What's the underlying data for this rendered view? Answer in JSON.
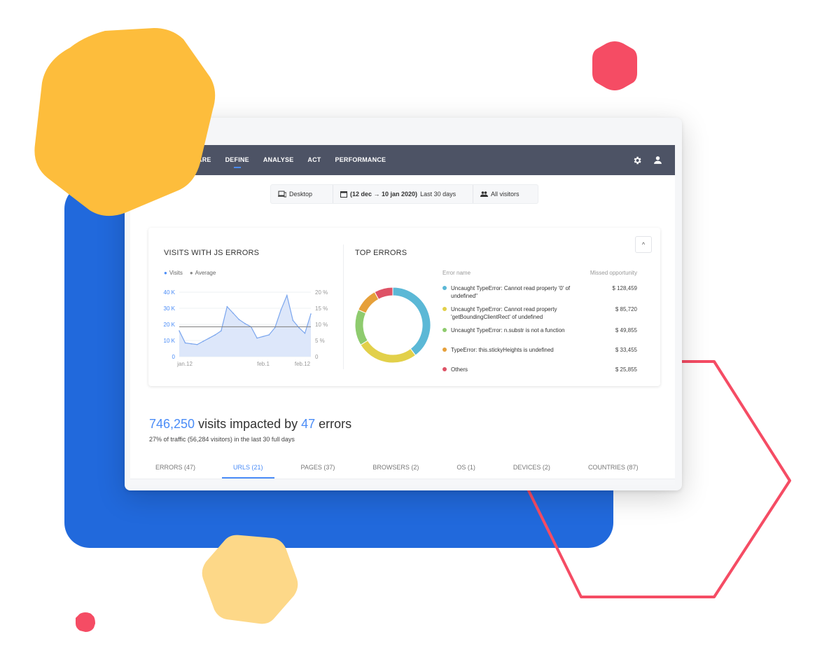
{
  "colors": {
    "accent": "#4a8cf7",
    "navbar": "#4d5365",
    "blue_panel": "#2169dc",
    "hex_yellow": "#fdbd3c",
    "hex_light_yellow": "#fdd888",
    "hex_red": "#f54c64"
  },
  "navbar": {
    "items": [
      {
        "label": "ARE",
        "active": false
      },
      {
        "label": "DEFINE",
        "active": true
      },
      {
        "label": "ANALYSE",
        "active": false
      },
      {
        "label": "ACT",
        "active": false
      },
      {
        "label": "PERFORMANCE",
        "active": false
      }
    ],
    "icons": [
      "gear-icon",
      "user-icon"
    ]
  },
  "filters": {
    "device": "Desktop",
    "date_range_bold": "(12 dec → 10 jan 2020)",
    "date_range_label": "Last 30 days",
    "segment": "All visitors"
  },
  "visits_card": {
    "title": "VISITS WITH JS ERRORS",
    "legend": [
      "Visits",
      "Average"
    ]
  },
  "top_errors": {
    "title": "TOP ERRORS",
    "col_name": "Error name",
    "col_value": "Missed opportunity",
    "collapse_label": "^",
    "rows": [
      {
        "name": "Uncaught TypeError: Cannot read property '0' of undefined\"",
        "value": "$ 128,459",
        "color": "#5bb8d6"
      },
      {
        "name": "Uncaught TypeError: Cannot read property 'getBoundingClientRect' of undefined",
        "value": "$ 85,720",
        "color": "#e2d04a"
      },
      {
        "name": "Uncaught TypeError: n.substr is not a function",
        "value": "$ 49,855",
        "color": "#8ecb6e"
      },
      {
        "name": "TypeError: this.stickyHeights is undefined",
        "value": "$ 33,455",
        "color": "#e6a03a"
      },
      {
        "name": "Others",
        "value": "$ 25,855",
        "color": "#de5266"
      }
    ]
  },
  "chart_data": [
    {
      "type": "area",
      "title": "VISITS WITH JS ERRORS",
      "series": [
        {
          "name": "Visits",
          "values": [
            16,
            8.5,
            8,
            7.5,
            9.5,
            11.5,
            13.5,
            16,
            31,
            27,
            23,
            20.5,
            18.5,
            11.5,
            12.5,
            13.5,
            18,
            29,
            38,
            22.5,
            18,
            14.5,
            26.5
          ]
        },
        {
          "name": "Average",
          "values": [
            18.5
          ]
        }
      ],
      "x_ticks": [
        "jan.12",
        "feb.1",
        "feb.12"
      ],
      "y_left_ticks": [
        "0",
        "10 K",
        "20 K",
        "30 K",
        "40 K"
      ],
      "y_right_ticks": [
        "0",
        "5 %",
        "10 %",
        "15 %",
        "20 %"
      ],
      "ylim": [
        0,
        40
      ],
      "y_unit": "K",
      "grid": true,
      "legend": "top-left"
    },
    {
      "type": "pie",
      "title": "TOP ERRORS",
      "categories": [
        "Uncaught TypeError: Cannot read property '0' of undefined\"",
        "Uncaught TypeError: Cannot read property 'getBoundingClientRect' of undefined",
        "Uncaught TypeError: n.substr is not a function",
        "TypeError: this.stickyHeights is undefined",
        "Others"
      ],
      "values": [
        128459,
        85720,
        49855,
        33455,
        25855
      ],
      "colors": [
        "#5bb8d6",
        "#e2d04a",
        "#8ecb6e",
        "#e6a03a",
        "#de5266"
      ],
      "donut": true
    }
  ],
  "summary": {
    "visits": "746,250",
    "visits_text": " visits impacted by ",
    "errors": "47",
    "errors_text": " errors",
    "subtitle": "27% of traffic (56,284 visitors) in the last 30 full days"
  },
  "tabs": [
    {
      "label": "ERRORS (47)",
      "active": false
    },
    {
      "label": "URLS (21)",
      "active": true
    },
    {
      "label": "PAGES (37)",
      "active": false
    },
    {
      "label": "BROWSERS (2)",
      "active": false
    },
    {
      "label": "OS (1)",
      "active": false
    },
    {
      "label": "DEVICES (2)",
      "active": false
    },
    {
      "label": "COUNTRIES (87)",
      "active": false
    }
  ]
}
